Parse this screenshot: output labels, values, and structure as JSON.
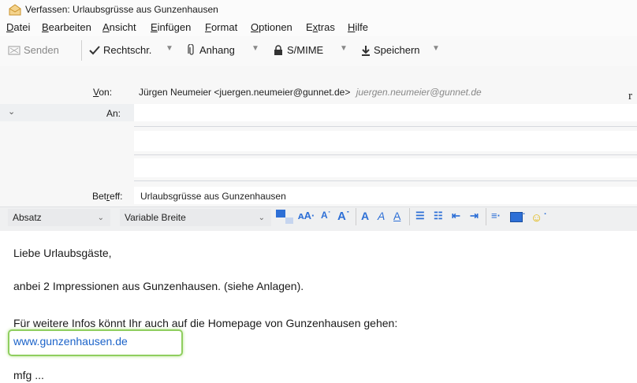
{
  "window": {
    "title": "Verfassen: Urlaubsgrüsse aus Gunzenhausen"
  },
  "menu": [
    {
      "pre": "",
      "u": "D",
      "post": "atei"
    },
    {
      "pre": "",
      "u": "B",
      "post": "earbeiten"
    },
    {
      "pre": "",
      "u": "A",
      "post": "nsicht"
    },
    {
      "pre": "",
      "u": "E",
      "post": "infügen"
    },
    {
      "pre": "",
      "u": "F",
      "post": "ormat"
    },
    {
      "pre": "",
      "u": "O",
      "post": "ptionen"
    },
    {
      "pre": "E",
      "u": "x",
      "post": "tras"
    },
    {
      "pre": "",
      "u": "H",
      "post": "ilfe"
    }
  ],
  "toolbar": {
    "send": "Senden",
    "spell": "Rechtschr.",
    "attach": "Anhang",
    "smime": "S/MIME",
    "save": "Speichern"
  },
  "header": {
    "from_label_u": "V",
    "from_label_rest": "on:",
    "from_value": "Jürgen Neumeier <juergen.neumeier@gunnet.de>",
    "from_alias": "juergen.neumeier@gunnet.de",
    "to_label": "An:",
    "subject_label_pre": "Bet",
    "subject_label_u": "r",
    "subject_label_post": "eff:",
    "subject_value": "Urlaubsgrüsse aus Gunzenhausen",
    "cut_char": "r"
  },
  "format": {
    "paragraph": "Absatz",
    "font": "Variable Breite"
  },
  "body": {
    "greeting": "Liebe Urlaubsgäste,",
    "line1": "anbei 2 Impressionen aus Gunzenhausen. (siehe Anlagen).",
    "line2": "Für weitere Infos könnt Ihr auch auf die Homepage von Gunzenhausen gehen:",
    "link": "www.gunzenhausen.de",
    "closing": "mfg   ..."
  },
  "colors": {
    "link": "#1c63c9",
    "highlight": "#8fce5f",
    "accent": "#2d6fd6"
  }
}
